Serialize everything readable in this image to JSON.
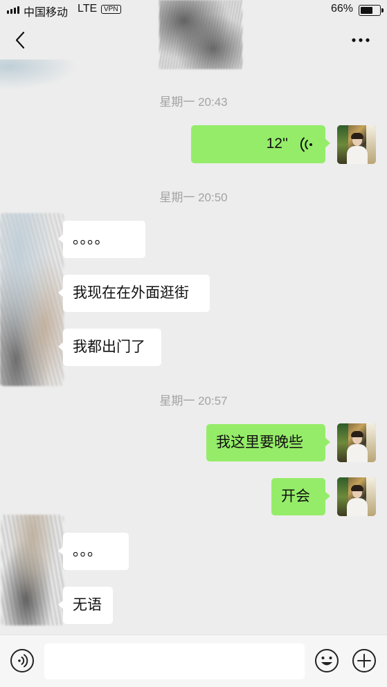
{
  "status_bar": {
    "carrier": "中国移动",
    "network": "LTE",
    "vpn_badge": "VPN",
    "battery_percent": "66%",
    "battery_level": 0.66
  },
  "nav": {
    "back_icon": "chevron-left-icon",
    "more_icon": "ellipsis-icon"
  },
  "colors": {
    "background": "#ededed",
    "sent_bubble": "#95ec69",
    "received_bubble": "#ffffff",
    "timestamp": "#a3a3a3"
  },
  "chat": {
    "timestamps": [
      "星期一 20:43",
      "星期一 20:50",
      "星期一 20:57"
    ],
    "messages": [
      {
        "side": "sent",
        "type": "voice",
        "text": "12''"
      },
      {
        "side": "received",
        "type": "text",
        "text": "。。。。"
      },
      {
        "side": "received",
        "type": "text",
        "text": "我现在在外面逛街"
      },
      {
        "side": "received",
        "type": "text",
        "text": "我都出门了"
      },
      {
        "side": "sent",
        "type": "text",
        "text": "我这里要晚些"
      },
      {
        "side": "sent",
        "type": "text",
        "text": "开会"
      },
      {
        "side": "received",
        "type": "text",
        "text": "。。。"
      },
      {
        "side": "received",
        "type": "text",
        "text": "无语"
      }
    ]
  },
  "input_bar": {
    "voice_toggle_icon": "voice-mode-icon",
    "input_value": "",
    "emoji_icon": "emoji-icon",
    "plus_icon": "plus-circle-icon"
  }
}
